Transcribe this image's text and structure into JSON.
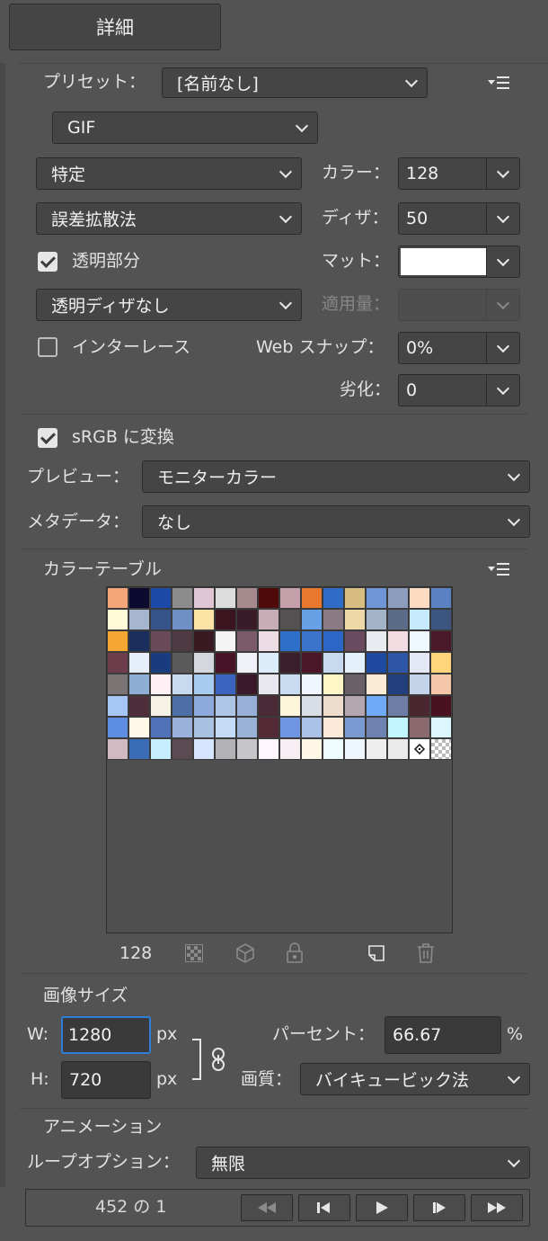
{
  "header": {
    "title": "詳細"
  },
  "preset": {
    "label": "プリセット：",
    "value": "[名前なし]"
  },
  "format": {
    "value": "GIF"
  },
  "reduction": {
    "value": "特定"
  },
  "colors": {
    "label": "カラー：",
    "value": "128"
  },
  "dither_algorithm": {
    "value": "誤差拡散法"
  },
  "dither": {
    "label": "ディザ：",
    "value": "50"
  },
  "transparency": {
    "label": "透明部分",
    "checked": true
  },
  "matte": {
    "label": "マット：",
    "color": "#ffffff"
  },
  "transparency_dither": {
    "value": "透明ディザなし"
  },
  "amount": {
    "label": "適用量：",
    "value": ""
  },
  "interlaced": {
    "label": "インターレース",
    "checked": false
  },
  "web_snap": {
    "label": "Web スナップ：",
    "value": "0%"
  },
  "lossy": {
    "label": "劣化：",
    "value": "0"
  },
  "srgb": {
    "label": "sRGB に変換",
    "checked": true
  },
  "preview": {
    "label": "プレビュー：",
    "value": "モニターカラー"
  },
  "metadata": {
    "label": "メタデータ：",
    "value": "なし"
  },
  "color_table": {
    "title": "カラーテーブル",
    "count": "128",
    "colors": [
      "#f5a57a",
      "#0c0a2e",
      "#1d4aa6",
      "#8c8c8c",
      "#e0c6d4",
      "#dcdcdc",
      "#a78a8e",
      "#4f0a0a",
      "#c4a0ab",
      "#e8782e",
      "#2f6cc8",
      "#d8bd82",
      "#6e96d6",
      "#8d9dbd",
      "#fbdcc2",
      "#5a82c2",
      "#fffbd8",
      "#a7b6cf",
      "#37548a",
      "#6f90c4",
      "#fbe3a6",
      "#3a1520",
      "#3a1c28",
      "#c8acb6",
      "#555052",
      "#68a0e6",
      "#8a7a84",
      "#efd8a8",
      "#a4b4c8",
      "#5a6c88",
      "#c6e9fb",
      "#3c5480",
      "#f5a732",
      "#1a2e5e",
      "#6a4a58",
      "#4e3a42",
      "#3a1a22",
      "#f4f4f4",
      "#7a5a68",
      "#ecdce4",
      "#2f6fca",
      "#3a74ca",
      "#2c66c6",
      "#6a4a5e",
      "#e8ecf0",
      "#f2dce2",
      "#f0f8ff",
      "#4a1a2a",
      "#6c3e4c",
      "#e6eefa",
      "#1a3c7e",
      "#5a5a5a",
      "#d4d8de",
      "#4a1428",
      "#f0f0f8",
      "#dcecfa",
      "#3a1e2c",
      "#4a1628",
      "#c8daf0",
      "#e4f0fa",
      "#1e4aa0",
      "#2e56a6",
      "#e4e8f4",
      "#ffd47a",
      "#7a7474",
      "#8eaed6",
      "#fff0f6",
      "#c8daf0",
      "#a8ccf0",
      "#3a64c0",
      "#3a1a2a",
      "#e8e6ee",
      "#cadcf2",
      "#f0f6ff",
      "#fff6c6",
      "#6a6068",
      "#fbead6",
      "#233e7c",
      "#c4d2ea",
      "#f6c6a8",
      "#a6c6f6",
      "#4e2e3a",
      "#f6f2e6",
      "#4e6ea6",
      "#8eaadc",
      "#aec6e6",
      "#98b0d8",
      "#4a2a36",
      "#fef6da",
      "#d8dde6",
      "#eedccc",
      "#b4a6ae",
      "#6eaaf6",
      "#6e7ea6",
      "#4a2630",
      "#4a1220",
      "#5e8ee2",
      "#fff8e8",
      "#5072b8",
      "#9ab2da",
      "#aac2e2",
      "#c4dcf6",
      "#9ab2d6",
      "#532a36",
      "#6e96e2",
      "#aac2e6",
      "#fde9d8",
      "#7a9ad2",
      "#6e82b2",
      "#c2f6fe",
      "#8a6a6e",
      "#dcf6fe",
      "#d2bac2",
      "#3a6cb6",
      "#c6eefe",
      "#5a4a52",
      "#d6e4fe",
      "#b2b2b6",
      "#c6c6ca",
      "#fff6fe",
      "#f6eef2",
      "#fef6e6",
      "#eefefe",
      "#eef6fe",
      "#eeeeee",
      "#eaeaea",
      "#ffffff",
      "#cccccc"
    ]
  },
  "image_size": {
    "title": "画像サイズ",
    "w_label": "W:",
    "w_value": "1280",
    "w_unit": "px",
    "h_label": "H:",
    "h_value": "720",
    "h_unit": "px",
    "percent_label": "パーセント：",
    "percent_value": "66.67",
    "percent_unit": "%",
    "quality_label": "画質：",
    "quality_value": "バイキュービック法"
  },
  "animation": {
    "title": "アニメーション",
    "loop_label": "ループオプション：",
    "loop_value": "無限",
    "frame_counter": "452 の 1"
  }
}
